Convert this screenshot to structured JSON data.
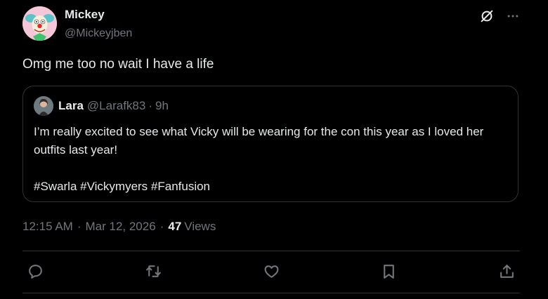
{
  "tweet": {
    "author_name": "Mickey",
    "author_handle": "@Mickeyjben",
    "text": "Omg me too no wait I have a life",
    "time": "12:15 AM",
    "date": "Mar 12, 2026",
    "views_count": "47",
    "views_label": "Views"
  },
  "quote": {
    "author_name": "Lara",
    "author_handle": "@Larafk83",
    "time_ago": "9h",
    "text": "I’m really excited to see what Vicky will be wearing for the con this year as I loved her outfits last year!",
    "hashtags": "#Swarla #Vickymyers #Fanfusion"
  },
  "icons": {
    "top": [
      "grok-icon",
      "more-icon"
    ],
    "actions": [
      "reply-icon",
      "retweet-icon",
      "like-icon",
      "bookmark-icon",
      "share-icon"
    ]
  },
  "colors": {
    "background": "#000000",
    "text": "#e7e9ea",
    "secondary_text": "#71767b",
    "border": "#2f3336"
  }
}
